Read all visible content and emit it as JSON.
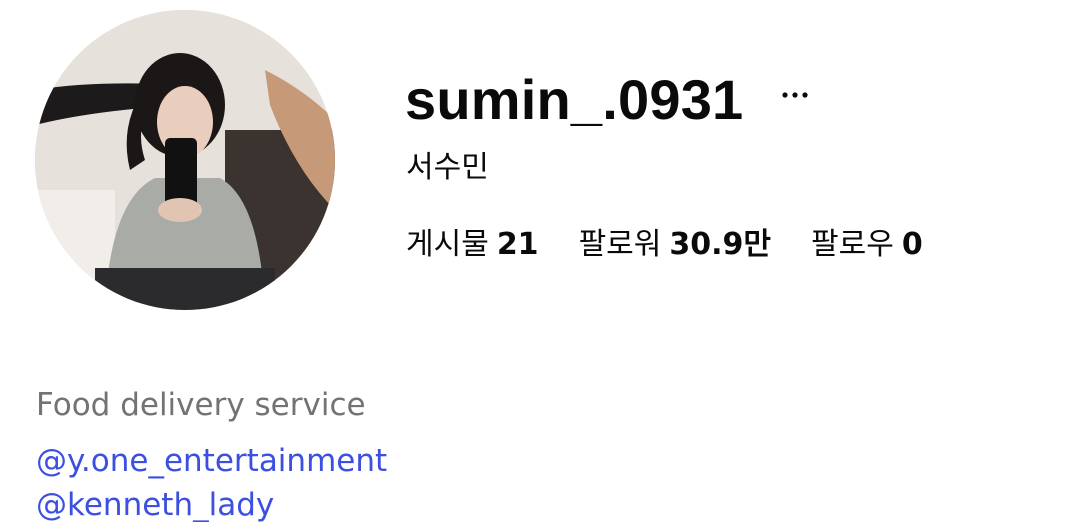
{
  "profile": {
    "username": "sumin_.0931",
    "full_name": "서수민",
    "more_icon": "more-horizontal-icon"
  },
  "stats": {
    "posts_label": "게시물",
    "posts_value": "21",
    "followers_label": "팔로워",
    "followers_value": "30.9만",
    "following_label": "팔로우",
    "following_value": "0"
  },
  "bio": {
    "category": "Food delivery service",
    "mentions": [
      "@y.one_entertainment",
      "@kenneth_lady"
    ]
  },
  "colors": {
    "text": "#0a0a0a",
    "muted": "#737373",
    "link": "#3b4fe0"
  }
}
